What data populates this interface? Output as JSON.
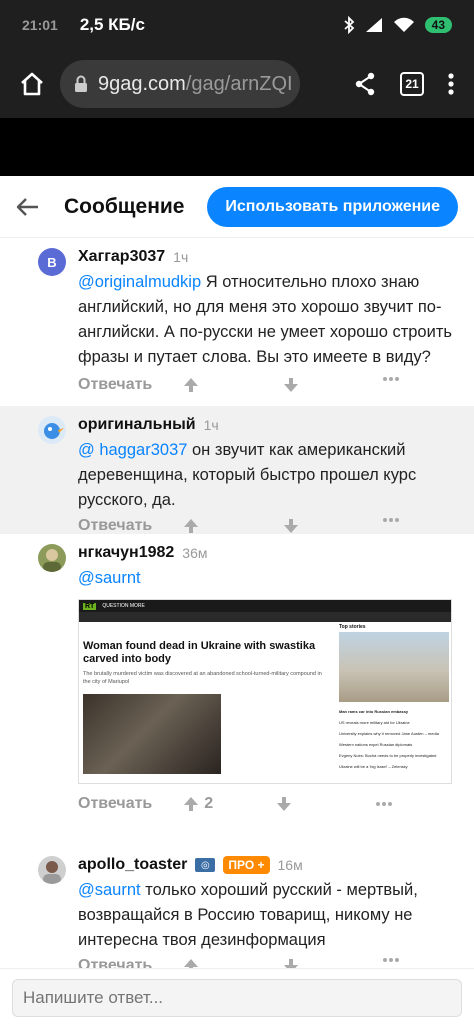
{
  "status": {
    "time": "21:01",
    "network_speed": "2,5 КБ/с",
    "battery": "43"
  },
  "browser": {
    "url_host": "9gag.com",
    "url_path": "/gag/arnZQI",
    "tabs_count": "21"
  },
  "app_header": {
    "title": "Сообщение",
    "use_app_label": "Использовать приложение"
  },
  "comments": [
    {
      "avatar_letter": "B",
      "username": "Хаггар3037",
      "time": "1ч",
      "mention": "@originalmudkip",
      "text": " Я относительно плохо знаю английский, но для меня это хорошо звучит по-английски. А по-русски не умеет хорошо строить фразы и путает слова. Вы это имеете в виду?",
      "reply_label": "Отвечать"
    },
    {
      "username": "оригинальный",
      "time": "1ч",
      "mention": "@ haggar3037",
      "text": " он звучит как американский деревенщина, который быстро прошел курс русского, да.",
      "reply_label": "Отвечать"
    },
    {
      "username": "нгкачун1982",
      "time": "36м",
      "mention": "@saurnt",
      "text": "",
      "reply_label": "Отвечать",
      "upvotes": "2",
      "embed": {
        "brand": "RT",
        "question_more": "QUESTION MORE",
        "headline": "Woman found dead in Ukraine with swastika carved into body",
        "subheadline": "The brutally murdered victim was discovered at an abandoned school-turned-military compound in the city of Mariupol",
        "side_title": "Top stories",
        "side_headline": "Man rams car into Russian embassy",
        "side_items": [
          "US reveals more military aid for Ukraine",
          "University explains why it removed Jane Austen – media",
          "Western nations expel Russian diplomats",
          "Evgeny Noirs: Bucha needs to be properly investigated",
          "Ukraine will be a 'big Israel' – Zelensky"
        ]
      }
    },
    {
      "username": "apollo_toaster",
      "pro_label": "ПРО +",
      "time": "16м",
      "mention": "@saurnt",
      "text": " только хороший русский - мертвый, возвращайся в Россию товарищ, никому не интересна твоя дезинформация",
      "reply_label": "Отвечать"
    }
  ],
  "reply_input": {
    "placeholder": "Напишите ответ..."
  },
  "colors": {
    "accent": "#0a84ff",
    "pro_badge": "#ff8a00",
    "battery": "#2fbf71"
  },
  "icons": [
    "home-icon",
    "share-icon",
    "more-vert-icon",
    "back-arrow-icon",
    "upvote-icon",
    "downvote-icon",
    "more-horiz-icon",
    "bluetooth-icon",
    "signal-icon",
    "wifi-icon",
    "lock-icon"
  ]
}
